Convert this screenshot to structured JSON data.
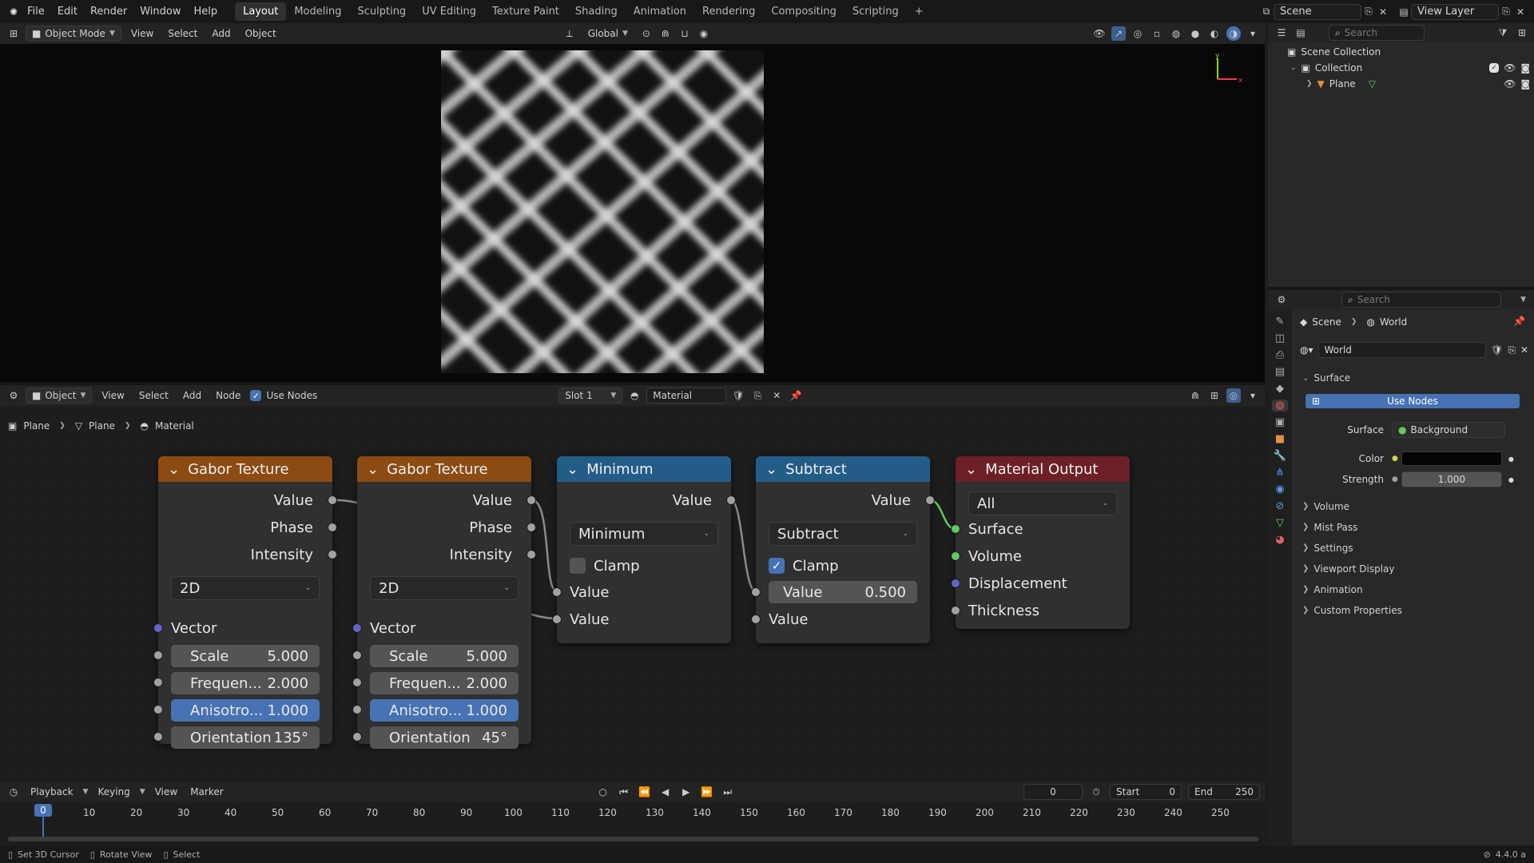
{
  "menubar": {
    "menus": [
      "File",
      "Edit",
      "Render",
      "Window",
      "Help"
    ],
    "workspaces": [
      "Layout",
      "Modeling",
      "Sculpting",
      "UV Editing",
      "Texture Paint",
      "Shading",
      "Animation",
      "Rendering",
      "Compositing",
      "Scripting"
    ],
    "active_workspace": "Layout",
    "scene": "Scene",
    "view_layer": "View Layer"
  },
  "viewport_header": {
    "mode": "Object Mode",
    "menus": [
      "View",
      "Select",
      "Add",
      "Object"
    ],
    "orientation": "Global"
  },
  "outliner": {
    "search_placeholder": "Search",
    "items": [
      "Scene Collection",
      "Collection",
      "Plane"
    ]
  },
  "properties": {
    "search_placeholder": "Search",
    "breadcrumb": [
      "Scene",
      "World"
    ],
    "world_name": "World",
    "surface_section": "Surface",
    "use_nodes": "Use Nodes",
    "surface_label": "Surface",
    "surface_value": "Background",
    "color_label": "Color",
    "strength_label": "Strength",
    "strength_value": "1.000",
    "sections": [
      "Volume",
      "Mist Pass",
      "Settings",
      "Viewport Display",
      "Animation",
      "Custom Properties"
    ]
  },
  "node_header": {
    "editor_type": "Object",
    "menus": [
      "View",
      "Select",
      "Add",
      "Node"
    ],
    "use_nodes": "Use Nodes",
    "slot": "Slot 1",
    "material": "Material"
  },
  "node_breadcrumb": [
    "Plane",
    "Plane",
    "Material"
  ],
  "nodes": {
    "gabor1": {
      "title": "Gabor Texture",
      "out_value": "Value",
      "out_phase": "Phase",
      "out_intensity": "Intensity",
      "dim": "2D",
      "vector": "Vector",
      "scale_l": "Scale",
      "scale_v": "5.000",
      "freq_l": "Frequen...",
      "freq_v": "2.000",
      "aniso_l": "Anisotro...",
      "aniso_v": "1.000",
      "orient_l": "Orientation",
      "orient_v": "135°"
    },
    "gabor2": {
      "title": "Gabor Texture",
      "out_value": "Value",
      "out_phase": "Phase",
      "out_intensity": "Intensity",
      "dim": "2D",
      "vector": "Vector",
      "scale_l": "Scale",
      "scale_v": "5.000",
      "freq_l": "Frequen...",
      "freq_v": "2.000",
      "aniso_l": "Anisotro...",
      "aniso_v": "1.000",
      "orient_l": "Orientation",
      "orient_v": "45°"
    },
    "minimum": {
      "title": "Minimum",
      "out_value": "Value",
      "op": "Minimum",
      "clamp": "Clamp",
      "in1": "Value",
      "in2": "Value"
    },
    "subtract": {
      "title": "Subtract",
      "out_value": "Value",
      "op": "Subtract",
      "clamp": "Clamp",
      "in1_l": "Value",
      "in1_v": "0.500",
      "in2": "Value"
    },
    "output": {
      "title": "Material Output",
      "target": "All",
      "surface": "Surface",
      "volume": "Volume",
      "displacement": "Displacement",
      "thickness": "Thickness"
    }
  },
  "timeline": {
    "menus": [
      "Playback",
      "Keying",
      "View",
      "Marker"
    ],
    "current_frame": "0",
    "start_label": "Start",
    "start_value": "0",
    "end_label": "End",
    "end_value": "250",
    "ticks": [
      "0",
      "10",
      "20",
      "30",
      "40",
      "50",
      "60",
      "70",
      "80",
      "90",
      "100",
      "110",
      "120",
      "130",
      "140",
      "150",
      "160",
      "170",
      "180",
      "190",
      "200",
      "210",
      "220",
      "230",
      "240",
      "250"
    ]
  },
  "statusbar": {
    "hints": [
      "Set 3D Cursor",
      "Rotate View",
      "Select"
    ],
    "version": "4.4.0 a"
  }
}
